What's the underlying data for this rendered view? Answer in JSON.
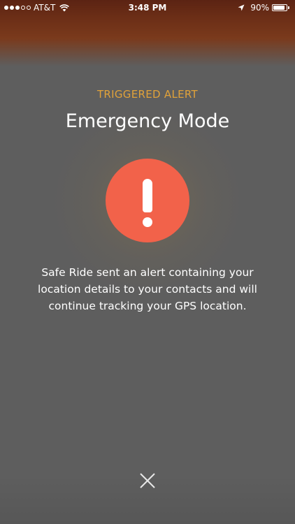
{
  "status_bar": {
    "carrier": "AT&T",
    "time": "3:48 PM",
    "battery_percent_label": "90%",
    "battery_level": 0.9,
    "signal_bars_filled": 3,
    "signal_bars_total": 5,
    "icons": [
      "wifi-icon",
      "location-arrow-icon",
      "battery-icon"
    ]
  },
  "alert": {
    "label": "TRIGGERED ALERT",
    "title": "Emergency Mode",
    "icon": "exclamation-icon",
    "message": "Safe Ride sent an alert containing your location details to your contacts and will continue tracking your GPS location."
  },
  "close": {
    "icon": "close-icon"
  },
  "colors": {
    "accent_label": "#e0a23a",
    "alert_circle": "#f2624a",
    "background": "#5e5e5e",
    "header_tint": "#6a2d16"
  }
}
